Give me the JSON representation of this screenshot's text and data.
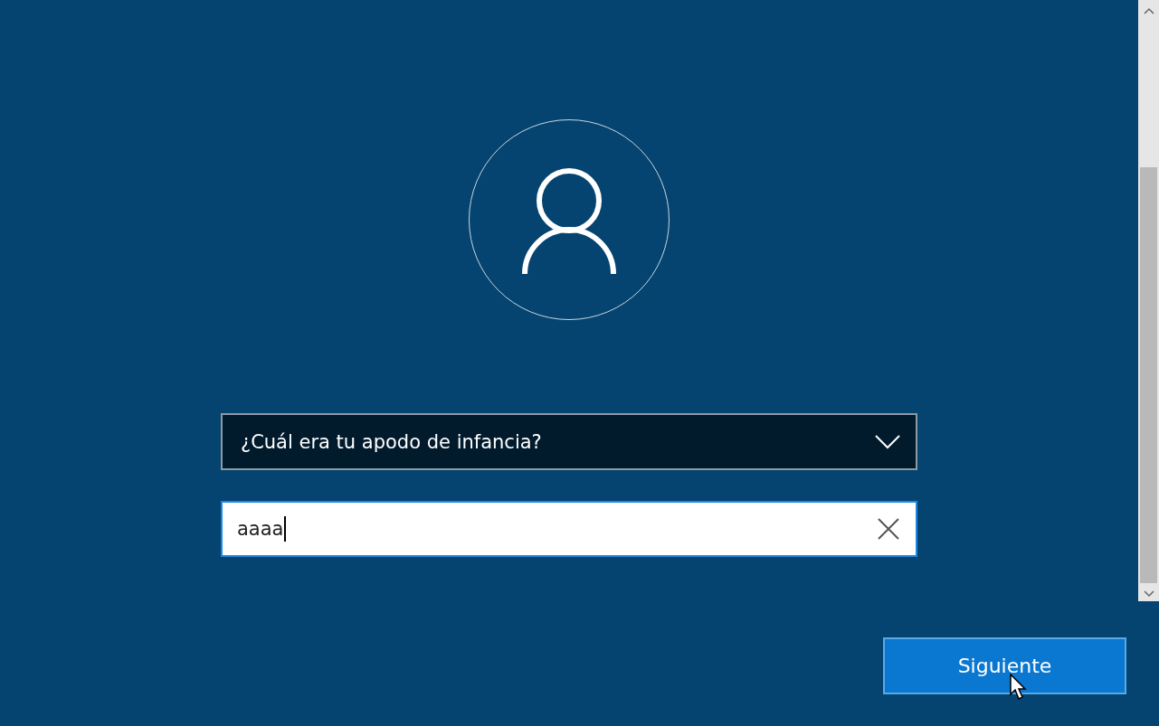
{
  "security_question": {
    "value": "¿Cuál era tu apodo de infancia?"
  },
  "answer_field": {
    "value": "aaaa"
  },
  "next_button": {
    "label": "Siguiente"
  }
}
